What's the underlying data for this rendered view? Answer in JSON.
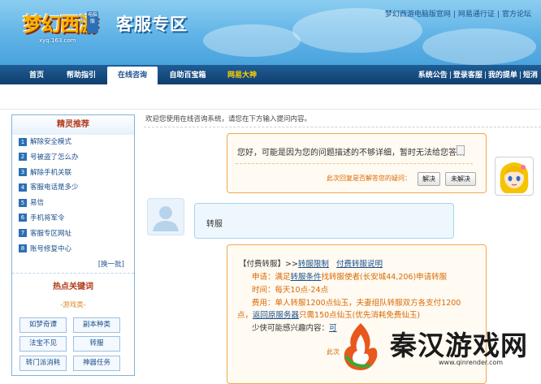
{
  "header": {
    "logo_text": "梦幻西游",
    "logo_tag": "电脑版",
    "logo_url": "xyq.163.com",
    "title": "客服专区",
    "top_links": [
      "梦幻西游电脑版官网",
      "网易通行证",
      "官方论坛"
    ]
  },
  "nav": {
    "tabs": [
      "首页",
      "帮助指引",
      "在线咨询",
      "自助百宝箱",
      "网易大神"
    ],
    "active_tab": "在线咨询",
    "right_links": [
      "系统公告",
      "登录客服",
      "我的提单",
      "短消"
    ]
  },
  "sidebar": {
    "title": "精灵推荐",
    "items": [
      {
        "num": "1",
        "label": "解除安全模式"
      },
      {
        "num": "2",
        "label": "号被盗了怎么办"
      },
      {
        "num": "3",
        "label": "解除手机关联"
      },
      {
        "num": "4",
        "label": "客服电话是多少"
      },
      {
        "num": "5",
        "label": "易信"
      },
      {
        "num": "6",
        "label": "手机将军令"
      },
      {
        "num": "7",
        "label": "客服专区网址"
      },
      {
        "num": "8",
        "label": "账号修复中心"
      }
    ],
    "more": "[换一批]",
    "hot_title": "热点关键词",
    "game_category": "-游戏类-",
    "keywords": [
      "如梦奇谭",
      "副本种类",
      "法宝不见",
      "转服",
      "转门派消耗",
      "神器任务"
    ]
  },
  "chat": {
    "welcome": "欢迎您使用在线咨询系统，请您在下方输入提问内容。",
    "bot_reply_1": "您好，可能是因为您的问题描述的不够详细，暂时无法给您答案",
    "feedback_question": "此次回复是否解答您的疑问：",
    "solved_button": "解决",
    "unsolved_button": "未解决",
    "user_message": "转服",
    "bot_reply_2": {
      "line1_prefix": "【付费转服】>>",
      "line1_link1": "转服限制",
      "line1_link2": "付费转服说明",
      "line2_a": "申请：满足",
      "line2_link": "转服条件",
      "line2_b": "找转服使者(长安城44,206)申请转服",
      "line3": "时间：每天10点-24点",
      "line4": "费用：单人转服1200点仙玉，夫妻组队转服双方各支付1200",
      "line5_a": "点，",
      "line5_link": "返回原服务器",
      "line5_b": "只需150点仙玉(优先消耗免费仙玉)",
      "line6": "少侠可能感兴趣内容：",
      "line6_more": "可",
      "footer_partial": "此次"
    }
  },
  "watermark": {
    "text": "秦汉游戏网",
    "url": "www.qinrender.com"
  },
  "colors": {
    "header_blue": "#5fb3e6",
    "nav_dark": "#103e6e",
    "link_blue": "#1b4f8a",
    "accent_orange": "#d86a00",
    "title_red": "#b33a1a"
  }
}
